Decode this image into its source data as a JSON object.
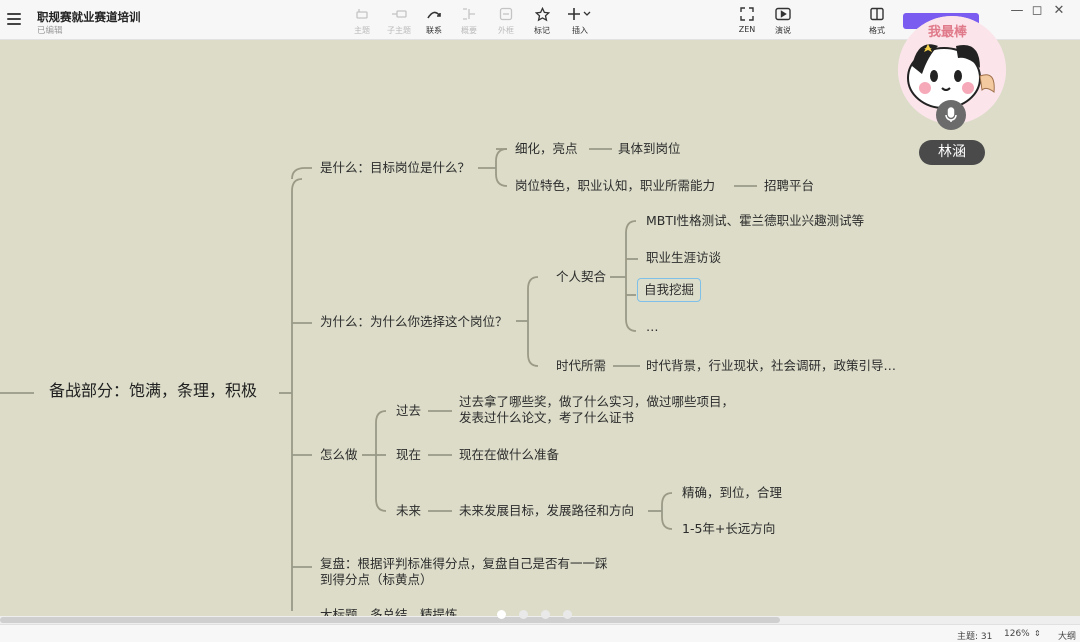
{
  "app": {
    "title": "职规赛就业赛道培训",
    "status": "已编辑"
  },
  "toolbar": {
    "tools": [
      {
        "label": "主题",
        "icon": "topic-icon"
      },
      {
        "label": "子主题",
        "icon": "subtopic-icon"
      },
      {
        "label": "联系",
        "icon": "relationship-icon"
      },
      {
        "label": "概要",
        "icon": "summary-icon"
      },
      {
        "label": "外框",
        "icon": "boundary-icon"
      },
      {
        "label": "标记",
        "icon": "star-icon"
      },
      {
        "label": "插入",
        "icon": "plus-icon"
      },
      {
        "label": "ZEN",
        "icon": "fullscreen-icon"
      },
      {
        "label": "演说",
        "icon": "play-icon"
      },
      {
        "label": "格式",
        "icon": "format-panel-icon"
      }
    ]
  },
  "mindmap": {
    "root": "备战部分：饱满，条理，积极",
    "what": {
      "label": "是什么：目标岗位是什么？",
      "c1": "细化，亮点",
      "c1a": "具体到岗位",
      "c2": "岗位特色，职业认知，职业所需能力",
      "c2a": "招聘平台"
    },
    "why": {
      "label": "为什么：为什么你选择这个岗位？",
      "personal": "个人契合",
      "p1": "MBTI性格测试、霍兰德职业兴趣测试等",
      "p2": "职业生涯访谈",
      "p3": "自我挖掘",
      "p4": "…",
      "era": "时代所需",
      "era1": "时代背景，行业现状，社会调研，政策引导…"
    },
    "how": {
      "label": "怎么做",
      "past": "过去",
      "past1": "过去拿了哪些奖，做了什么实习，做过哪些项目，发表过什么论文，考了什么证书",
      "now": "现在",
      "now1": "现在在做什么准备",
      "future": "未来",
      "future1": "未来发展目标，发展路径和方向",
      "f1": "精确，到位，合理",
      "f2": "1-5年+长远方向"
    },
    "review": "复盘：根据评判标准得分点，复盘自己是否有一一踩到得分点（标黄点）",
    "cut": "大标题，多总结，精提炼"
  },
  "overlay": {
    "name": "林涵",
    "badge_text": "我最棒"
  },
  "statusbar": {
    "topics_label": "主题: 31",
    "zoom": "126%",
    "outline": "大纲"
  }
}
